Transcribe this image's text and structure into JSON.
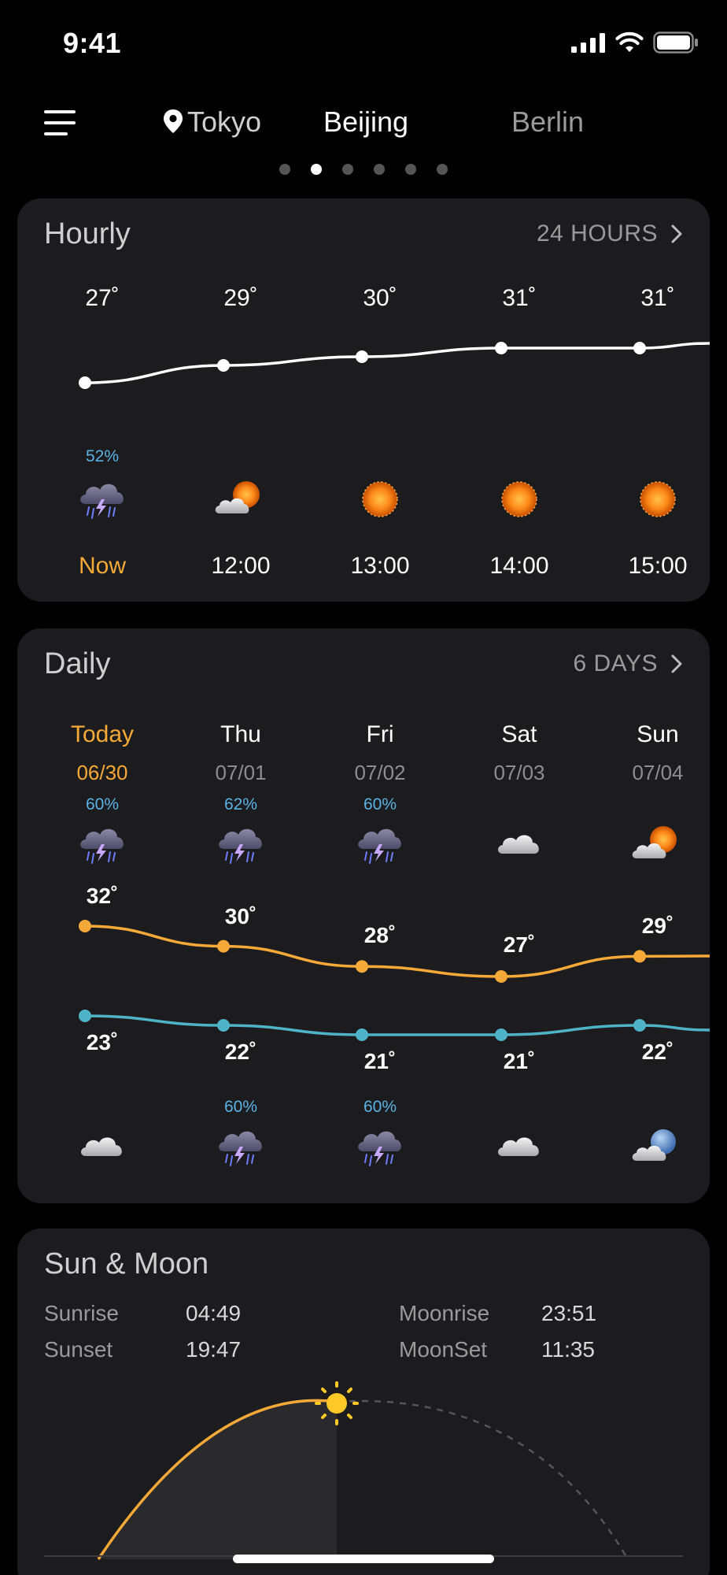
{
  "status": {
    "time": "9:41"
  },
  "nav": {
    "menu_icon": "hamburger-icon",
    "location_icon": "location-pin-icon",
    "cities": [
      "Tokyo",
      "Beijing",
      "Berlin"
    ],
    "active_city_index": 1,
    "page_count": 6,
    "active_page_index": 1
  },
  "hourly": {
    "title": "Hourly",
    "link_label": "24 HOURS",
    "items": [
      {
        "temp": "27˚",
        "precip": "52%",
        "icon": "thunderstorm-icon",
        "time": "Now"
      },
      {
        "temp": "29˚",
        "precip": "",
        "icon": "partly-sunny-icon",
        "time": "12:00"
      },
      {
        "temp": "30˚",
        "precip": "",
        "icon": "sun-icon",
        "time": "13:00"
      },
      {
        "temp": "31˚",
        "precip": "",
        "icon": "sun-icon",
        "time": "14:00"
      },
      {
        "temp": "31˚",
        "precip": "",
        "icon": "sun-icon",
        "time": "15:00"
      }
    ],
    "temps_numeric": [
      27,
      29,
      30,
      31,
      31
    ]
  },
  "daily": {
    "title": "Daily",
    "link_label": "6 DAYS",
    "days": [
      {
        "day": "Today",
        "date": "06/30",
        "day_precip": "60%",
        "day_icon": "thunderstorm-icon",
        "high": "32˚",
        "low": "23˚",
        "night_precip": "",
        "night_icon": "cloudy-icon"
      },
      {
        "day": "Thu",
        "date": "07/01",
        "day_precip": "62%",
        "day_icon": "thunderstorm-icon",
        "high": "30˚",
        "low": "22˚",
        "night_precip": "60%",
        "night_icon": "thunderstorm-icon"
      },
      {
        "day": "Fri",
        "date": "07/02",
        "day_precip": "60%",
        "day_icon": "thunderstorm-icon",
        "high": "28˚",
        "low": "21˚",
        "night_precip": "60%",
        "night_icon": "thunderstorm-icon"
      },
      {
        "day": "Sat",
        "date": "07/03",
        "day_precip": "",
        "day_icon": "cloudy-icon",
        "high": "27˚",
        "low": "21˚",
        "night_precip": "",
        "night_icon": "cloudy-icon"
      },
      {
        "day": "Sun",
        "date": "07/04",
        "day_precip": "",
        "day_icon": "partly-sunny-icon",
        "high": "29˚",
        "low": "22˚",
        "night_precip": "",
        "night_icon": "partly-cloudy-night-icon"
      }
    ],
    "highs_numeric": [
      32,
      30,
      28,
      27,
      29
    ],
    "lows_numeric": [
      23,
      22,
      21,
      21,
      22
    ]
  },
  "sun_moon": {
    "title": "Sun & Moon",
    "sunrise_label": "Sunrise",
    "sunrise": "04:49",
    "sunset_label": "Sunset",
    "sunset": "19:47",
    "moonrise_label": "Moonrise",
    "moonrise": "23:51",
    "moonset_label": "MoonSet",
    "moonset": "11:35",
    "sun_icon": "sun-icon"
  },
  "colors": {
    "accent": "#f5a938",
    "high_line": "#f5a938",
    "low_line": "#4fb3c8",
    "precip": "#5ab2e6",
    "card": "#1c1c1e"
  }
}
